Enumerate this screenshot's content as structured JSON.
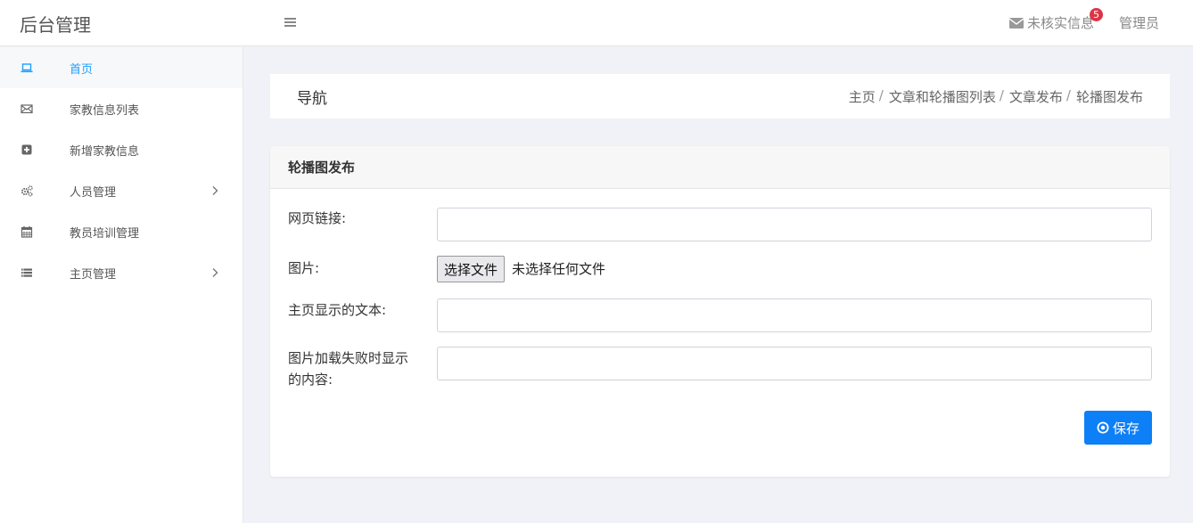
{
  "header": {
    "brand": "后台管理",
    "unverified_label": "未核实信息",
    "unverified_count": "5",
    "user": "管理员"
  },
  "sidebar": {
    "items": [
      {
        "label": "首页",
        "icon": "laptop-icon",
        "active": true
      },
      {
        "label": "家教信息列表",
        "icon": "envelope-icon"
      },
      {
        "label": "新增家教信息",
        "icon": "plus-square-icon"
      },
      {
        "label": "人员管理",
        "icon": "gears-icon",
        "has_children": true
      },
      {
        "label": "教员培训管理",
        "icon": "calendar-icon"
      },
      {
        "label": "主页管理",
        "icon": "list-icon",
        "has_children": true
      }
    ]
  },
  "breadcrumb_panel": {
    "title": "导航",
    "crumbs": [
      "主页",
      "文章和轮播图列表",
      "文章发布",
      "轮播图发布"
    ],
    "separator": "/"
  },
  "form": {
    "title": "轮播图发布",
    "link_label": "网页链接:",
    "link_value": "",
    "image_label": "图片:",
    "file_button": "选择文件",
    "file_status": "未选择任何文件",
    "text_label": "主页显示的文本:",
    "text_value": "",
    "alt_label": "图片加载失败时显示的内容:",
    "alt_value": "",
    "save_label": "保存"
  },
  "colors": {
    "accent": "#1e9fff",
    "primary_button": "#0d7ff7",
    "badge": "#dc3545"
  }
}
